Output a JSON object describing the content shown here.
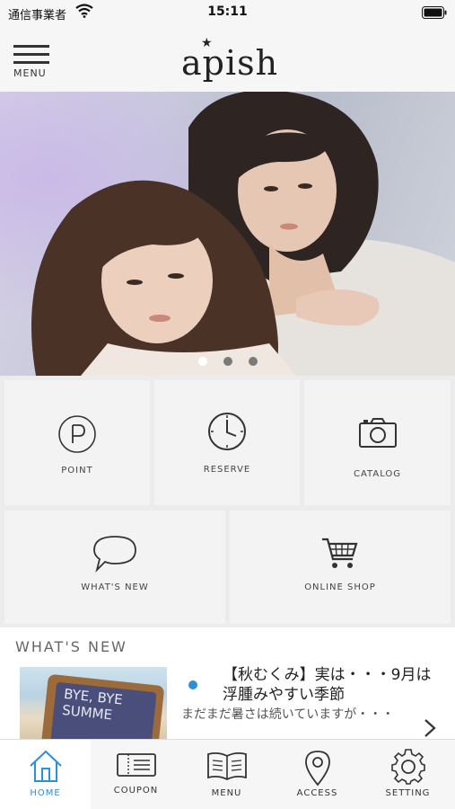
{
  "status_bar": {
    "carrier": "通信事業者",
    "time": "15:11"
  },
  "header": {
    "menu_label": "MENU",
    "logo_text": "apish"
  },
  "hero": {
    "slide_count": 3,
    "active_slide": 1
  },
  "grid": {
    "point": "POINT",
    "reserve": "RESERVE",
    "catalog": "CATALOG",
    "whats_new": "WHAT'S NEW",
    "online_shop": "ONLINE SHOP"
  },
  "whats_new": {
    "section_title": "WHAT'S NEW",
    "items": [
      {
        "thumb_text": "BYE, BYE SUMME",
        "title": "【秋むくみ】実は・・・9月は浮腫みやすい季節",
        "body": "まだまだ暑さは続いていますが・・・"
      }
    ]
  },
  "tabs": [
    {
      "label": "HOME",
      "icon": "home-icon",
      "active": true
    },
    {
      "label": "COUPON",
      "icon": "ticket-icon",
      "active": false
    },
    {
      "label": "MENU",
      "icon": "book-icon",
      "active": false
    },
    {
      "label": "ACCESS",
      "icon": "map-pin-icon",
      "active": false
    },
    {
      "label": "SETTING",
      "icon": "gear-icon",
      "active": false
    }
  ],
  "colors": {
    "accent": "#2d8fd6",
    "background": "#f6f6f6"
  }
}
